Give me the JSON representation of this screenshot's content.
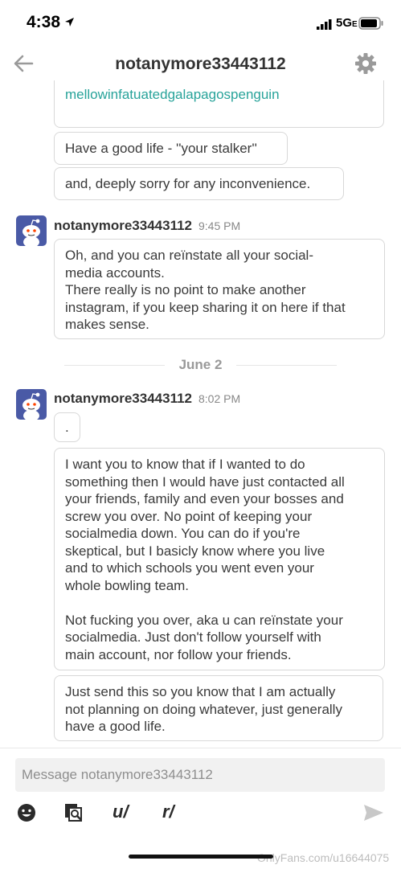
{
  "status_bar": {
    "time": "4:38",
    "network": "5G",
    "network_suffix": "E"
  },
  "header": {
    "title": "notanymore33443112"
  },
  "messages_top": [
    {
      "lines": [
        "mellowinfatuatedgalapagospenguin"
      ]
    },
    {
      "lines": [
        "Have a good life - ''your stalker''"
      ]
    },
    {
      "lines": [
        "and, deeply sorry for any inconvenience."
      ]
    }
  ],
  "group1": {
    "sender": "notanymore33443112",
    "time": "9:45 PM",
    "lines": [
      "Oh, and you can reïnstate all your social-",
      "media accounts.",
      "There really is no point to make another",
      "instagram, if you keep sharing it on here if that",
      "makes sense."
    ]
  },
  "date_separator": "June 2",
  "group2": {
    "sender": "notanymore33443112",
    "time": "8:02 PM",
    "dot_message": ".",
    "message_long": [
      "I want you to know that if I wanted to do",
      "something then I would have just contacted all",
      "your friends, family and even your bosses and",
      "screw you over. No point of keeping your",
      "socialmedia down. You can do if you're",
      "skeptical, but I basicly know where you live",
      "and to which schools you went even your",
      "whole bowling team.",
      "",
      "Not fucking you over, aka u can reïnstate your",
      "socialmedia. Just don't follow yourself with",
      "main account, nor follow your friends."
    ],
    "message_last": [
      "Just send this so you know that I am actually",
      "not planning on doing whatever, just generally",
      "have a good life."
    ]
  },
  "composer": {
    "placeholder": "Message notanymore33443112",
    "user_prefix": "u/",
    "sub_prefix": "r/"
  },
  "watermark": "OnlyFans.com/u16644075",
  "colors": {
    "link": "#28a39a",
    "avatar_bg": "#4a5aa6",
    "bubble_border": "#d8d8d8"
  }
}
